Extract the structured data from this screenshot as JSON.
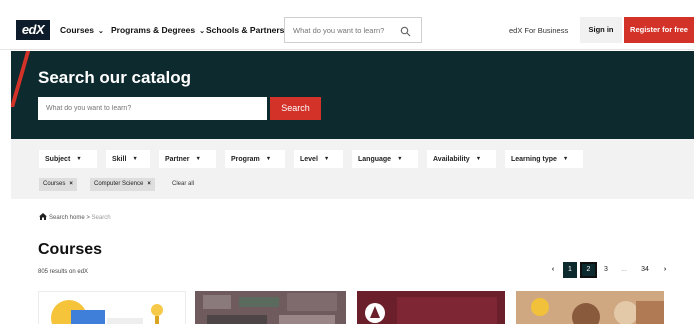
{
  "header": {
    "logo": "edX",
    "nav": [
      {
        "label": "Courses",
        "has_dropdown": true
      },
      {
        "label": "Programs & Degrees",
        "has_dropdown": true
      },
      {
        "label": "Schools & Partners",
        "has_dropdown": false
      }
    ],
    "search_placeholder": "What do you want to learn?",
    "business_link": "edX For Business",
    "sign_in": "Sign in",
    "register": "Register for free"
  },
  "hero": {
    "title": "Search our catalog",
    "search_placeholder": "What do you want to learn?",
    "search_button": "Search"
  },
  "filters": {
    "dropdowns": [
      "Subject",
      "Skill",
      "Partner",
      "Program",
      "Level",
      "Language",
      "Availability",
      "Learning type"
    ],
    "active_chips": [
      "Courses",
      "Computer Science"
    ],
    "clear_all": "Clear all"
  },
  "breadcrumb": {
    "home": "Search home",
    "separator": ">",
    "current": "Search"
  },
  "results": {
    "title": "Courses",
    "count_text": "805 results on edX"
  },
  "pagination": {
    "prev": "‹",
    "pages": [
      "1",
      "2",
      "3"
    ],
    "ellipsis": "...",
    "last": "34",
    "next": "›",
    "current": "2"
  },
  "colors": {
    "brand_red": "#d23228",
    "hero_bg": "#0d2a2e",
    "filter_bg": "#f2f2f2",
    "logo_bg": "#0d1b2a"
  }
}
